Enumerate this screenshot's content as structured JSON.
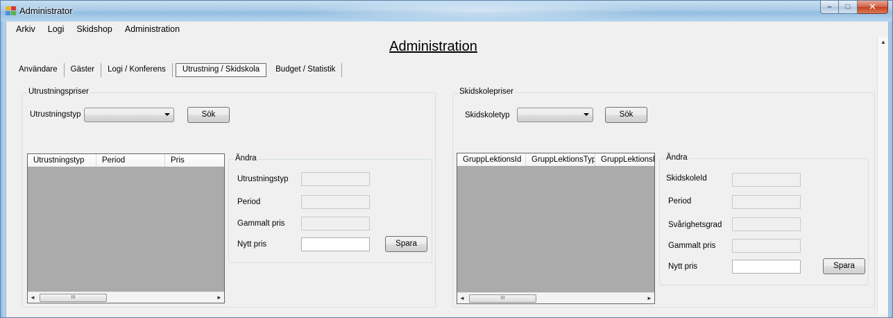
{
  "window": {
    "title": "Administrator",
    "controls": {
      "minimize": "–",
      "maximize": "□",
      "close": "✕"
    }
  },
  "menu": [
    "Arkiv",
    "Logi",
    "Skidshop",
    "Administration"
  ],
  "page_title": "Administration",
  "tabs": [
    {
      "label": "Användare",
      "active": false
    },
    {
      "label": "Gäster",
      "active": false
    },
    {
      "label": "Logi / Konferens",
      "active": false
    },
    {
      "label": "Utrustning / Skidskola",
      "active": true
    },
    {
      "label": "Budget / Statistik",
      "active": false
    }
  ],
  "equipment": {
    "group_label": "Utrustningspriser",
    "type_label": "Utrustningstyp",
    "type_value": "",
    "search_button": "Sök",
    "grid_columns": [
      "Utrustningstyp",
      "Period",
      "Pris"
    ],
    "edit": {
      "group_label": "Ändra",
      "fields": [
        {
          "label": "Utrustningstyp",
          "value": ""
        },
        {
          "label": "Period",
          "value": ""
        },
        {
          "label": "Gammalt pris",
          "value": ""
        },
        {
          "label": "Nytt pris",
          "value": ""
        }
      ],
      "save_button": "Spara"
    }
  },
  "ski_school": {
    "group_label": "Skidskolepriser",
    "type_label": "Skidskoletyp",
    "type_value": "",
    "search_button": "Sök",
    "grid_columns": [
      "GruppLektionsId",
      "GruppLektionsTyp",
      "GruppLektionsP"
    ],
    "edit": {
      "group_label": "Ändra",
      "fields": [
        {
          "label": "SkidskoleId",
          "value": ""
        },
        {
          "label": "Period",
          "value": ""
        },
        {
          "label": "Svårighetsgrad",
          "value": ""
        },
        {
          "label": "Gammalt pris",
          "value": ""
        },
        {
          "label": "Nytt pris",
          "value": ""
        }
      ],
      "save_button": "Spara"
    }
  },
  "scroll": {
    "left_arrow": "◄",
    "right_arrow": "►",
    "up_arrow": "▲",
    "thumb_grip": "III"
  },
  "colors": {
    "accent": "#93bde0",
    "grid_bg": "#ababab",
    "close": "#c2401f"
  }
}
